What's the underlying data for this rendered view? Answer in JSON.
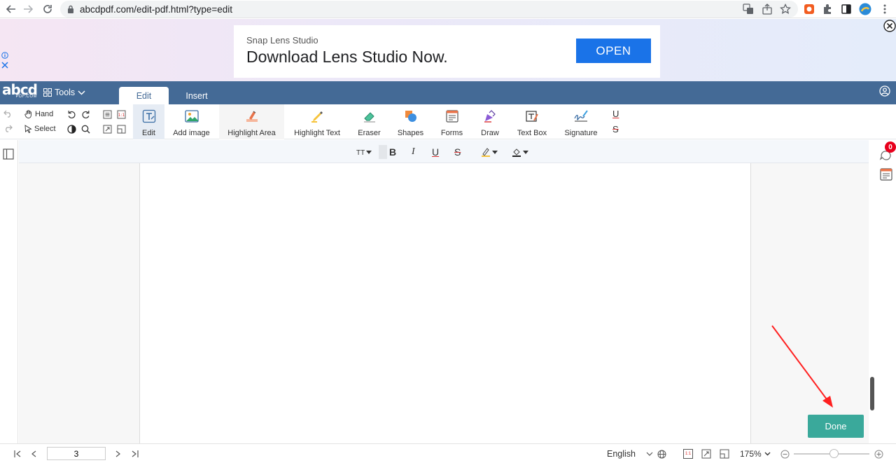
{
  "browser": {
    "url": "abcdpdf.com/edit-pdf.html?type=edit"
  },
  "ad": {
    "advertiser": "Snap Lens Studio",
    "headline": "Download Lens Studio Now.",
    "cta": "OPEN"
  },
  "app": {
    "logo_main": "abcd",
    "logo_sub": "PDF.COM",
    "tools_label": "Tools",
    "tabs": [
      "Edit",
      "Insert"
    ],
    "active_tab": "Edit"
  },
  "toolbar": {
    "hand_label": "Hand",
    "select_label": "Select",
    "tools": [
      {
        "label": "Edit",
        "icon": "text-edit-icon"
      },
      {
        "label": "Add image",
        "icon": "image-icon"
      },
      {
        "label": "Highlight Area",
        "icon": "highlight-area-icon"
      },
      {
        "label": "Highlight Text",
        "icon": "highlighter-icon"
      },
      {
        "label": "Eraser",
        "icon": "eraser-icon"
      },
      {
        "label": "Shapes",
        "icon": "shapes-icon"
      },
      {
        "label": "Forms",
        "icon": "forms-icon"
      },
      {
        "label": "Draw",
        "icon": "pen-icon"
      },
      {
        "label": "Text Box",
        "icon": "text-box-icon"
      },
      {
        "label": "Signature",
        "icon": "signature-icon"
      }
    ],
    "underline_glyph": "U",
    "strike_glyph": "S"
  },
  "format_bar": {
    "font_size_glyph": "TT",
    "bold": "B",
    "italic": "I",
    "underline": "U",
    "strikethrough": "S"
  },
  "comments_badge": "0",
  "done_label": "Done",
  "footer": {
    "current_page": "3",
    "language": "English",
    "zoom": "175%",
    "actual_size_label": "1:1",
    "zoom_slider_position": 0.53
  },
  "colors": {
    "header_bg": "#446a96",
    "done_bg": "#3aa99b",
    "ad_cta_bg": "#1a73e8",
    "badge_bg": "#e8001c",
    "annotation_arrow": "#ff2020"
  }
}
